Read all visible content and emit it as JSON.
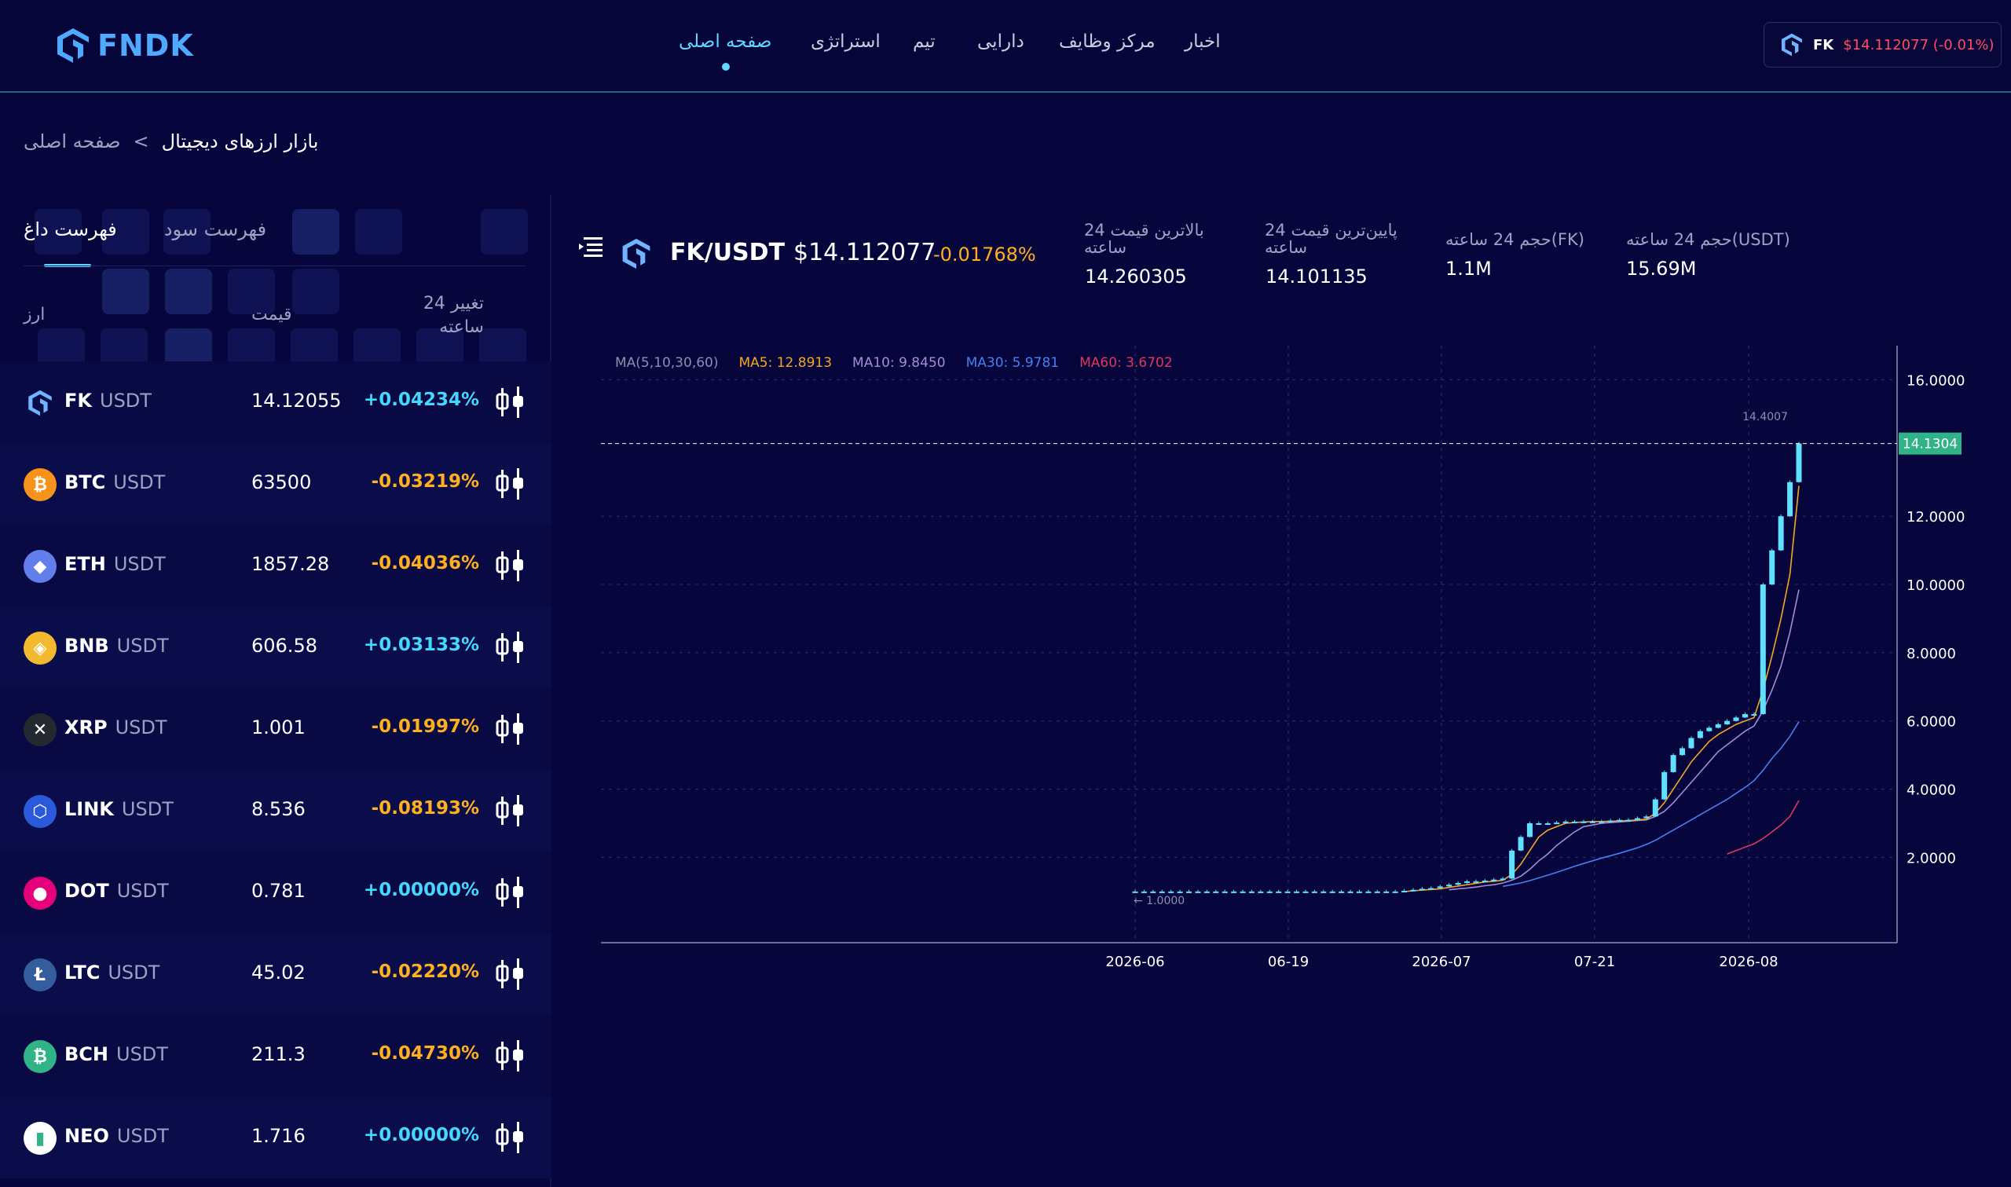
{
  "brand": {
    "name": "FNDK",
    "accent": "#4fa9ff"
  },
  "nav": {
    "items": [
      {
        "label": "صفحه اصلی",
        "active": true
      },
      {
        "label": "استراتژی"
      },
      {
        "label": "تیم"
      },
      {
        "label": "دارایی"
      },
      {
        "label": "مرکز وظایف"
      },
      {
        "label": "اخبار"
      }
    ]
  },
  "ticker": {
    "symbol": "FK",
    "value": "$14.112077 (-0.01%)"
  },
  "breadcrumb": {
    "home": "صفحه اصلی",
    "current": "بازار ارزهای دیجیتال",
    "sep": "<"
  },
  "market_list": {
    "tabs": [
      {
        "label": "فهرست داغ",
        "active": true
      },
      {
        "label": "فهرست سود"
      }
    ],
    "columns": {
      "coin": "ارز",
      "price": "قیمت",
      "change": "تغییر 24 ساعته"
    },
    "rows": [
      {
        "symbol": "FK",
        "quote": "USDT",
        "price": "14.12055",
        "change": "+0.04234%",
        "dir": "up",
        "icon_color": "#0d1050",
        "icon": "fk-logo-icon"
      },
      {
        "symbol": "BTC",
        "quote": "USDT",
        "price": "63500",
        "change": "-0.03219%",
        "dir": "down",
        "icon_color": "#f7931a",
        "icon": "btc-icon",
        "glyph": "₿"
      },
      {
        "symbol": "ETH",
        "quote": "USDT",
        "price": "1857.28",
        "change": "-0.04036%",
        "dir": "down",
        "icon_color": "#627eea",
        "icon": "eth-icon",
        "glyph": "◆"
      },
      {
        "symbol": "BNB",
        "quote": "USDT",
        "price": "606.58",
        "change": "+0.03133%",
        "dir": "up",
        "icon_color": "#f3ba2f",
        "icon": "bnb-icon",
        "glyph": "◈"
      },
      {
        "symbol": "XRP",
        "quote": "USDT",
        "price": "1.001",
        "change": "-0.01997%",
        "dir": "down",
        "icon_color": "#23292f",
        "icon": "xrp-icon",
        "glyph": "✕"
      },
      {
        "symbol": "LINK",
        "quote": "USDT",
        "price": "8.536",
        "change": "-0.08193%",
        "dir": "down",
        "icon_color": "#2a5ada",
        "icon": "link-icon",
        "glyph": "⬡"
      },
      {
        "symbol": "DOT",
        "quote": "USDT",
        "price": "0.781",
        "change": "+0.00000%",
        "dir": "up",
        "icon_color": "#e6007a",
        "icon": "dot-icon",
        "glyph": "●"
      },
      {
        "symbol": "LTC",
        "quote": "USDT",
        "price": "45.02",
        "change": "-0.02220%",
        "dir": "down",
        "icon_color": "#345d9d",
        "icon": "ltc-icon",
        "glyph": "Ł"
      },
      {
        "symbol": "BCH",
        "quote": "USDT",
        "price": "211.3",
        "change": "-0.04730%",
        "dir": "down",
        "icon_color": "#2fb387",
        "icon": "bch-icon",
        "glyph": "₿"
      },
      {
        "symbol": "NEO",
        "quote": "USDT",
        "price": "1.716",
        "change": "+0.00000%",
        "dir": "up",
        "icon_color": "#ffffff",
        "icon": "neo-icon",
        "glyph": "▮"
      }
    ]
  },
  "pair": {
    "name": "FK/USDT",
    "price": "$14.112077",
    "change": "-0.01768%",
    "stats": [
      {
        "label": "بالاترین قیمت 24 ساعته",
        "value": "14.260305"
      },
      {
        "label": "پایین‌ترین قیمت 24 ساعته",
        "value": "14.101135"
      },
      {
        "label": "حجم 24 ساعته(FK)",
        "value": "1.1M"
      },
      {
        "label": "حجم 24 ساعته(USDT)",
        "value": "15.69M"
      }
    ]
  },
  "chart_data": {
    "type": "candlestick",
    "ma_legend": [
      {
        "label": "MA(5,10,30,60)",
        "color": "#8a8fb0"
      },
      {
        "label": "MA5: 12.8913",
        "color": "#f5a623"
      },
      {
        "label": "MA10: 9.8450",
        "color": "#a58bd8"
      },
      {
        "label": "MA30: 5.9781",
        "color": "#4a7ef0"
      },
      {
        "label": "MA60: 3.6702",
        "color": "#e0365a"
      }
    ],
    "yticks": [
      "16.0000",
      "12.0000",
      "10.0000",
      "8.0000",
      "6.0000",
      "4.0000",
      "2.0000"
    ],
    "ytick_values": [
      16,
      12,
      10,
      8,
      6,
      4,
      2
    ],
    "ylim": [
      -0.5,
      17
    ],
    "xticks": [
      "2026-06",
      "06-19",
      "2026-07",
      "07-21",
      "2026-08"
    ],
    "current_price_label": "14.1304",
    "current_price": 14.1304,
    "high_label": "14.4007",
    "high_value": 14.4007,
    "low_label": "← 1.0000",
    "low_value": 1.0,
    "candles": [
      1.0,
      1.0,
      1.0,
      1.0,
      1.0,
      1.0,
      1.0,
      1.0,
      1.0,
      1.0,
      1.0,
      1.0,
      1.0,
      1.0,
      1.0,
      1.0,
      1.0,
      1.0,
      1.0,
      1.0,
      1.0,
      1.0,
      1.0,
      1.0,
      1.0,
      1.0,
      1.0,
      1.0,
      1.0,
      1.0,
      1.02,
      1.05,
      1.08,
      1.1,
      1.15,
      1.2,
      1.25,
      1.3,
      1.3,
      1.32,
      1.35,
      1.38,
      2.2,
      2.6,
      3.0,
      3.0,
      3.0,
      3.02,
      3.05,
      3.05,
      3.05,
      3.05,
      3.05,
      3.08,
      3.1,
      3.1,
      3.15,
      3.2,
      3.7,
      4.5,
      5.0,
      5.2,
      5.5,
      5.7,
      5.8,
      5.9,
      6.0,
      6.1,
      6.2,
      6.2,
      10.0,
      11.0,
      12.0,
      13.0,
      14.13
    ],
    "ma5": [
      null,
      null,
      null,
      null,
      null,
      null,
      null,
      null,
      null,
      null,
      null,
      null,
      null,
      null,
      null,
      null,
      null,
      null,
      null,
      null,
      null,
      null,
      null,
      null,
      null,
      null,
      null,
      null,
      null,
      null,
      1.0,
      1.02,
      1.04,
      1.06,
      1.08,
      1.12,
      1.16,
      1.2,
      1.24,
      1.28,
      1.3,
      1.33,
      1.5,
      1.8,
      2.2,
      2.6,
      2.8,
      2.9,
      3.0,
      3.02,
      3.04,
      3.05,
      3.05,
      3.06,
      3.07,
      3.08,
      3.1,
      3.12,
      3.3,
      3.6,
      4.0,
      4.4,
      4.8,
      5.1,
      5.4,
      5.6,
      5.75,
      5.9,
      6.0,
      6.1,
      6.9,
      7.9,
      9.0,
      10.3,
      12.8913
    ],
    "ma10": [
      null,
      null,
      null,
      null,
      null,
      null,
      null,
      null,
      null,
      null,
      null,
      null,
      null,
      null,
      null,
      null,
      null,
      null,
      null,
      null,
      null,
      null,
      null,
      null,
      null,
      null,
      null,
      null,
      null,
      null,
      null,
      null,
      null,
      null,
      null,
      1.05,
      1.08,
      1.1,
      1.13,
      1.17,
      1.2,
      1.25,
      1.33,
      1.45,
      1.65,
      1.9,
      2.1,
      2.35,
      2.55,
      2.75,
      2.9,
      2.95,
      3.0,
      3.02,
      3.04,
      3.06,
      3.08,
      3.1,
      3.2,
      3.35,
      3.6,
      3.9,
      4.2,
      4.5,
      4.8,
      5.1,
      5.3,
      5.5,
      5.7,
      5.85,
      6.3,
      6.9,
      7.6,
      8.6,
      9.845
    ],
    "ma30": [
      null,
      null,
      null,
      null,
      null,
      null,
      null,
      null,
      null,
      null,
      null,
      null,
      null,
      null,
      null,
      null,
      null,
      null,
      null,
      null,
      null,
      null,
      null,
      null,
      null,
      null,
      null,
      null,
      null,
      null,
      null,
      null,
      null,
      null,
      null,
      null,
      null,
      null,
      null,
      null,
      null,
      1.15,
      1.2,
      1.25,
      1.32,
      1.4,
      1.48,
      1.56,
      1.65,
      1.74,
      1.82,
      1.9,
      1.98,
      2.05,
      2.12,
      2.2,
      2.28,
      2.38,
      2.5,
      2.65,
      2.8,
      2.95,
      3.1,
      3.25,
      3.4,
      3.55,
      3.7,
      3.88,
      4.05,
      4.25,
      4.55,
      4.9,
      5.2,
      5.55,
      5.9781
    ],
    "ma60": [
      null,
      null,
      null,
      null,
      null,
      null,
      null,
      null,
      null,
      null,
      null,
      null,
      null,
      null,
      null,
      null,
      null,
      null,
      null,
      null,
      null,
      null,
      null,
      null,
      null,
      null,
      null,
      null,
      null,
      null,
      null,
      null,
      null,
      null,
      null,
      null,
      null,
      null,
      null,
      null,
      null,
      null,
      null,
      null,
      null,
      null,
      null,
      null,
      null,
      null,
      null,
      null,
      null,
      null,
      null,
      null,
      null,
      null,
      null,
      null,
      null,
      null,
      null,
      null,
      null,
      null,
      2.1,
      2.2,
      2.3,
      2.4,
      2.55,
      2.75,
      2.95,
      3.2,
      3.6702
    ]
  }
}
